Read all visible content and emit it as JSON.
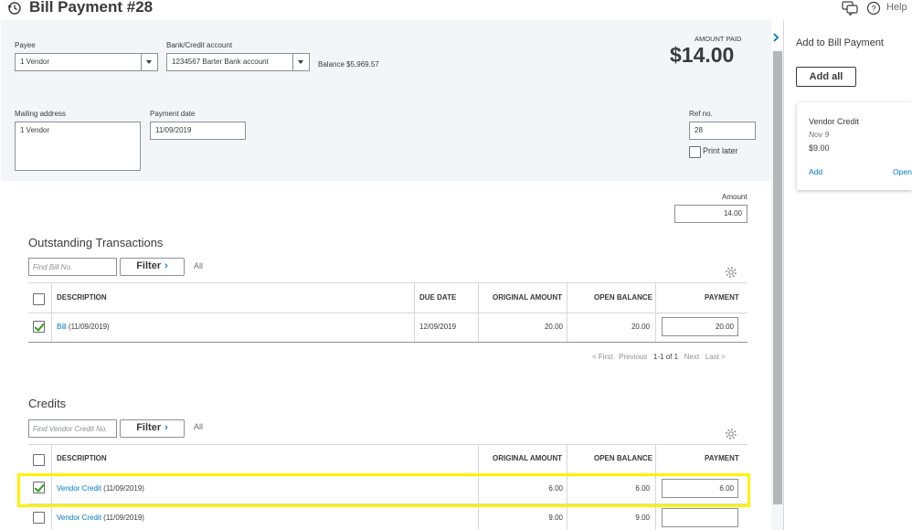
{
  "header": {
    "title": "Bill Payment #28",
    "help_label": "Help"
  },
  "form": {
    "payee_label": "Payee",
    "payee_value": "1 Vendor",
    "bank_label": "Bank/Credit account",
    "bank_value": "1234567 Barter Bank account",
    "balance_text": "Balance $5,969.57",
    "amount_paid_label": "AMOUNT PAID",
    "amount_paid_value": "$14.00",
    "mailing_label": "Mailing address",
    "mailing_value": "1 Vendor",
    "payment_date_label": "Payment date",
    "payment_date_value": "11/09/2019",
    "ref_label": "Ref no.",
    "ref_value": "28",
    "print_later_label": "Print later",
    "print_later_checked": false,
    "amount_label": "Amount",
    "amount_value": "14.00"
  },
  "outstanding": {
    "title": "Outstanding Transactions",
    "search_placeholder": "Find Bill No.",
    "filter_label": "Filter",
    "all_label": "All",
    "columns": {
      "description": "DESCRIPTION",
      "due_date": "DUE DATE",
      "original_amount": "ORIGINAL AMOUNT",
      "open_balance": "OPEN BALANCE",
      "payment": "PAYMENT"
    },
    "rows": [
      {
        "checked": true,
        "link": "Bill",
        "date": "(11/09/2019)",
        "due_date": "12/09/2019",
        "original_amount": "20.00",
        "open_balance": "20.00",
        "payment": "20.00"
      }
    ],
    "pager": {
      "first": "< First",
      "previous": "Previous",
      "range": "1-1 of 1",
      "next": "Next",
      "last": "Last >"
    }
  },
  "credits": {
    "title": "Credits",
    "search_placeholder": "Find Vendor Credit No.",
    "filter_label": "Filter",
    "all_label": "All",
    "columns": {
      "description": "DESCRIPTION",
      "original_amount": "ORIGINAL AMOUNT",
      "open_balance": "OPEN BALANCE",
      "payment": "PAYMENT"
    },
    "rows": [
      {
        "checked": true,
        "link": "Vendor Credit",
        "date": "(11/09/2019)",
        "original_amount": "6.00",
        "open_balance": "6.00",
        "payment": "6.00"
      },
      {
        "checked": false,
        "link": "Vendor Credit",
        "date": "(11/09/2019)",
        "original_amount": "9.00",
        "open_balance": "9.00",
        "payment": ""
      }
    ]
  },
  "side_panel": {
    "title": "Add to Bill Payment",
    "add_all_label": "Add all",
    "card": {
      "title": "Vendor Credit",
      "date": "Nov 9",
      "amount": "$9.00",
      "add_label": "Add",
      "open_label": "Open"
    }
  },
  "colors": {
    "link": "#0077c5",
    "check": "#2ca01c",
    "highlight": "#fff200",
    "header_bg": "#f4f5f8"
  }
}
